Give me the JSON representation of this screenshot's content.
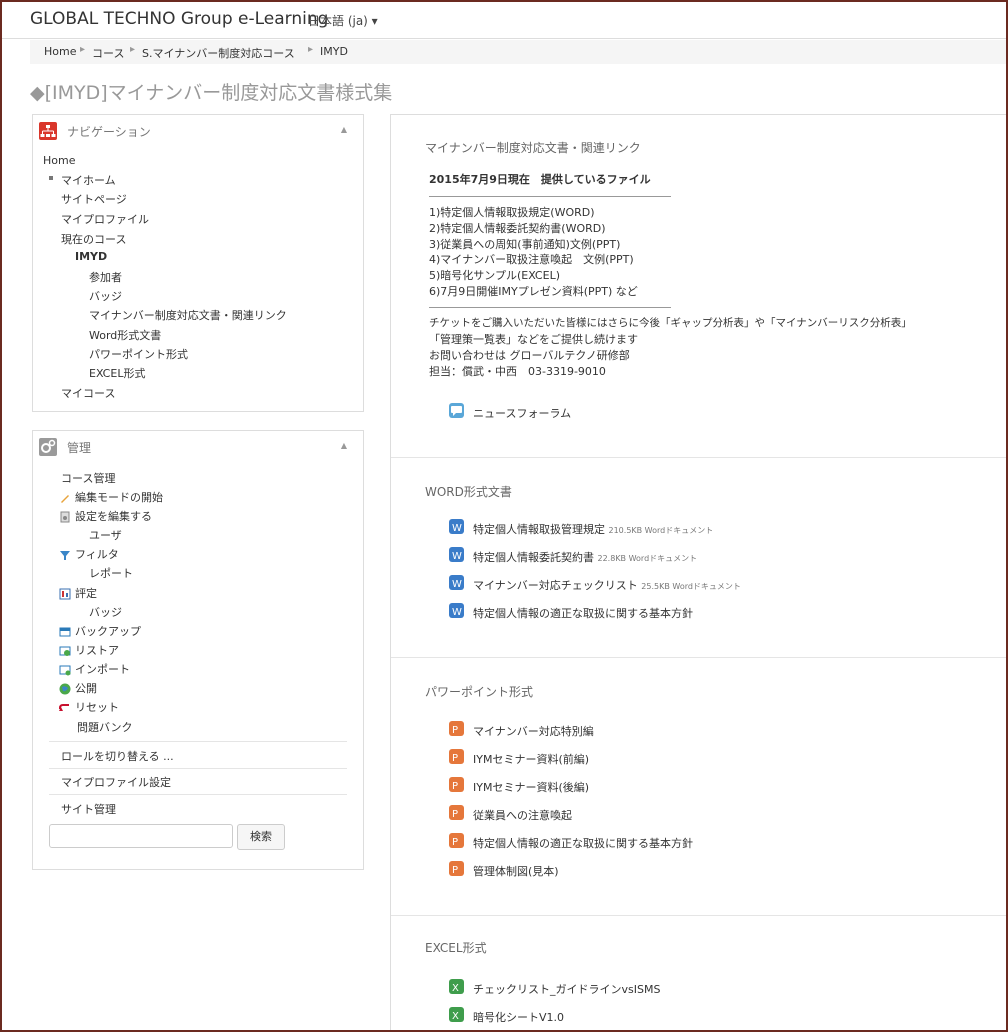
{
  "header": {
    "brand": "GLOBAL TECHNO Group e-Learning",
    "language": "日本語 (ja) ▾"
  },
  "breadcrumb": [
    "Home",
    "コース",
    "S.マイナンバー制度対応コース",
    "IMYD"
  ],
  "page_title": "◆[IMYD]マイナンバー制度対応文書様式集",
  "navigation": {
    "title": "ナビゲーション",
    "home": "Home",
    "myhome": "マイホーム",
    "site_pages": "サイトページ",
    "my_profile": "マイプロファイル",
    "current_course": "現在のコース",
    "course": "IMYD",
    "course_items": [
      "参加者",
      "バッジ",
      "マイナンバー制度対応文書・関連リンク",
      "Word形式文書",
      "パワーポイント形式",
      "EXCEL形式"
    ],
    "my_courses": "マイコース"
  },
  "admin": {
    "title": "管理",
    "course_admin": "コース管理",
    "items": [
      "編集モードの開始",
      "設定を編集する",
      "ユーザ",
      "フィルタ",
      "レポート",
      "評定",
      "バッジ",
      "バックアップ",
      "リストア",
      "インポート",
      "公開",
      "リセット",
      "問題バンク"
    ],
    "switch_role": "ロールを切り替える ...",
    "profile_settings": "マイプロファイル設定",
    "site_admin": "サイト管理",
    "search_placeholder": "",
    "search_button": "検索"
  },
  "sections": {
    "s0": {
      "title": "マイナンバー制度対応文書・関連リンク",
      "bold_line": "2015年7月9日現在　提供しているファイル",
      "lines": [
        "1)特定個人情報取扱規定(WORD)",
        "2)特定個人情報委託契約書(WORD)",
        "3)従業員への周知(事前通知)文例(PPT)",
        "4)マイナンバー取扱注意喚起　文例(PPT)",
        "5)暗号化サンプル(EXCEL)",
        "6)7月9日開催IMYプレゼン資料(PPT) など"
      ],
      "notes": [
        "チケットをご購入いただいた皆様にはさらに今後「ギャップ分析表」や「マイナンバーリスク分析表」",
        "「管理策一覧表」などをご提供し続けます",
        "お問い合わせは グローバルテクノ研修部",
        "担当：償武・中西　03-3319-9010"
      ],
      "forum": "ニュースフォーラム"
    },
    "word": {
      "title": "WORD形式文書",
      "items": [
        {
          "name": "特定個人情報取扱管理規定",
          "meta": "210.5KB Wordドキュメント"
        },
        {
          "name": "特定個人情報委託契約書",
          "meta": "22.8KB Wordドキュメント"
        },
        {
          "name": "マイナンバー対応チェックリスト",
          "meta": "25.5KB Wordドキュメント"
        },
        {
          "name": "特定個人情報の適正な取扱に関する基本方針",
          "meta": ""
        }
      ]
    },
    "ppt": {
      "title": "パワーポイント形式",
      "items": [
        "マイナンバー対応特別編",
        "IYMセミナー資料(前編)",
        "IYMセミナー資料(後編)",
        "従業員への注意喚起",
        "特定個人情報の適正な取扱に関する基本方針",
        "管理体制図(見本)"
      ]
    },
    "excel": {
      "title": "EXCEL形式",
      "items": [
        "チェックリスト_ガイドラインvsISMS",
        "暗号化シートV1.0"
      ]
    }
  },
  "colors": {
    "nav_icon": "#d9362b",
    "admin_icon": "#9a9a9a",
    "word_icon": "#3a7cc9",
    "ppt_icon": "#e5773b",
    "excel_icon": "#3f9d4c",
    "forum_icon": "#5aa7d8",
    "frame": "#6b2a20"
  }
}
